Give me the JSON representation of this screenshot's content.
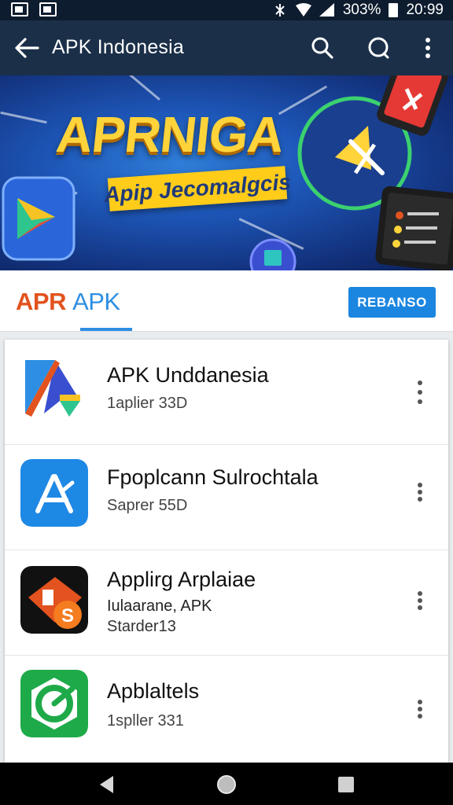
{
  "status_bar": {
    "battery_text": "303%",
    "time": "20:99"
  },
  "app_bar": {
    "title": "APK Indonesia"
  },
  "banner": {
    "title": "APRNIGA",
    "subtitle": "Apip Jecomalgcis"
  },
  "tabs": {
    "logo_part1": "APR",
    "logo_part2": "APK",
    "action_button": "REBANSO"
  },
  "list": [
    {
      "name": "APK Unddanesia",
      "sub1": "1aplier 33D",
      "sub2": "",
      "icon": "kite-app-icon"
    },
    {
      "name": "Fpoplcann Sulrochtala",
      "sub1": "Saprer 55D",
      "sub2": "",
      "icon": "app-store-a-icon"
    },
    {
      "name": "Applirg Arplaiae",
      "sub1": "Iulaarane, APK",
      "sub2": "Starder13",
      "icon": "ps-app-icon"
    },
    {
      "name": "Apblaltels",
      "sub1": "1spller 331",
      "sub2": "",
      "icon": "green-g-app-icon"
    }
  ],
  "colors": {
    "app_bar": "#1b2f48",
    "accent": "#1b86e0",
    "logo_orange": "#e2531f"
  }
}
